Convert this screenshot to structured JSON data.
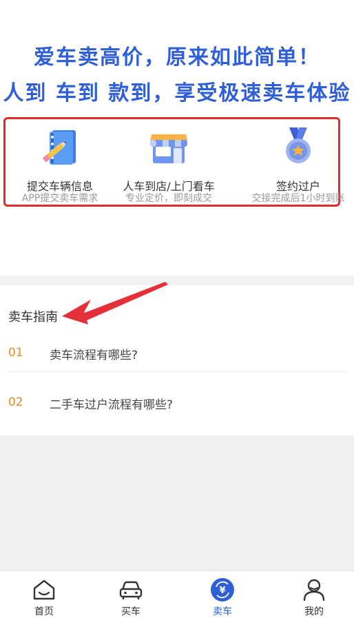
{
  "hero": {
    "line1": "爱车卖高价，原来如此简单！",
    "line2": "人到 车到 款到，享受极速卖车体验"
  },
  "steps": [
    {
      "icon": "notebook-pencil-icon",
      "title": "提交车辆信息",
      "sub": "APP提交卖车需求"
    },
    {
      "icon": "storefront-icon",
      "title": "人车到店/上门看车",
      "sub": "专业定价，即刻成交"
    },
    {
      "icon": "medal-icon",
      "title": "签约过户",
      "sub": "交接完成后1小时到账"
    }
  ],
  "guide": {
    "title": "卖车指南",
    "items": [
      {
        "num": "01",
        "question": "卖车流程有哪些?"
      },
      {
        "num": "02",
        "question": "二手车过户流程有哪些?"
      }
    ]
  },
  "tabbar": {
    "items": [
      {
        "icon": "home-icon",
        "label": "首页"
      },
      {
        "icon": "car-icon",
        "label": "买车"
      },
      {
        "icon": "yen-coin-icon",
        "label": "卖车",
        "active": true
      },
      {
        "icon": "user-icon",
        "label": "我的"
      }
    ]
  },
  "colors": {
    "accent": "#2f5fd6",
    "highlight_box": "#e02b2b",
    "number": "#e08b2c"
  }
}
